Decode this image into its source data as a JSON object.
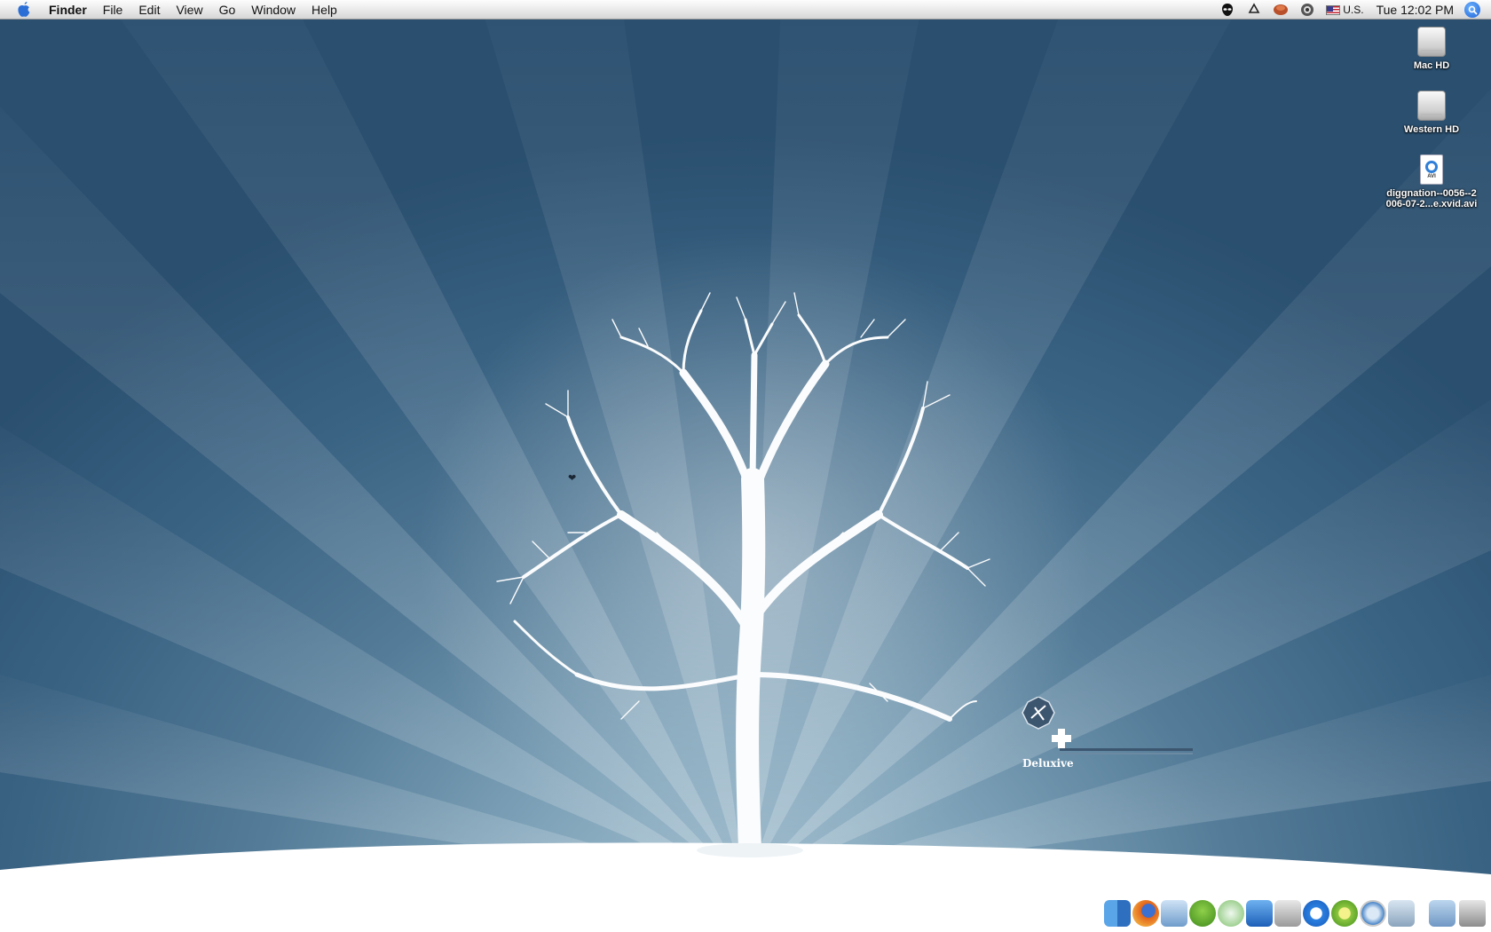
{
  "menubar": {
    "app_name": "Finder",
    "menus": [
      "File",
      "Edit",
      "View",
      "Go",
      "Window",
      "Help"
    ],
    "input_source": "U.S.",
    "clock": "Tue 12:02 PM"
  },
  "desktop_icons": [
    {
      "label": "Mac HD",
      "icon": "hard-drive-icon"
    },
    {
      "label": "Western HD",
      "icon": "hard-drive-icon"
    },
    {
      "label_line1": "diggnation--0056--2",
      "label_line2": "006-07-2...e.xvid.avi",
      "icon": "avi-file-icon",
      "badge": "AVI"
    }
  ],
  "wallpaper": {
    "signature": "Deluxive",
    "colors": {
      "sky_top": "#2a4f6f",
      "sky_glow": "#a9c4d3",
      "snow": "#ffffff"
    }
  },
  "dock": {
    "items": [
      "finder-icon",
      "firefox-icon",
      "preview-icon",
      "adium-icon",
      "itunes-icon",
      "word-icon",
      "system-preferences-icon",
      "quicktime-icon",
      "widget-icon",
      "safari-icon",
      "iphoto-icon",
      "documents-folder-icon",
      "trash-icon"
    ]
  }
}
